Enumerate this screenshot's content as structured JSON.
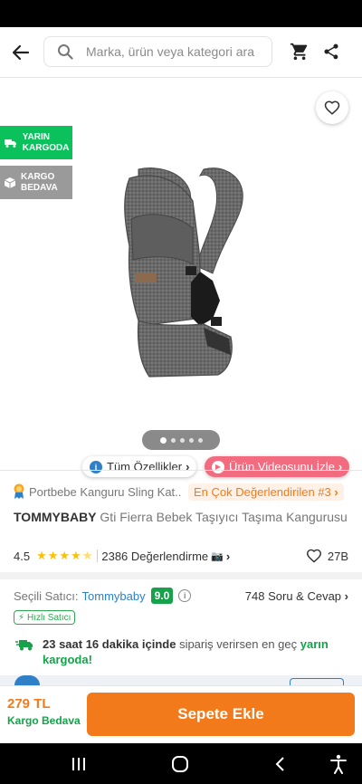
{
  "search": {
    "placeholder": "Marka, ürün veya kategori ara"
  },
  "badges": {
    "tomorrow_cargo": "YARIN KARGODA",
    "free_cargo": "KARGO BEDAVA"
  },
  "pills": {
    "all_features": "Tüm Özellikler",
    "watch_video": "Ürün Videosunu İzle"
  },
  "category": {
    "text": "Portbebe Kanguru Sling Kat...",
    "rank": "En Çok Değerlendirilen #3"
  },
  "product": {
    "brand": "TOMMYBABY",
    "name": "Gti Fierra Bebek Taşıyıcı Taşıma Kangurusu"
  },
  "rating": {
    "score": "4.5",
    "stars": 4.5,
    "reviews": "2386 Değerlendirme",
    "favorites": "27B"
  },
  "seller": {
    "label": "Seçili Satıcı:",
    "name": "Tommybaby",
    "score": "9.0",
    "qa": "748 Soru & Cevap",
    "fast_label": "Hızlı Satıcı"
  },
  "delivery": {
    "time": "23 saat 16 dakika içinde",
    "mid": "sipariş verirsen en geç",
    "day": "yarın kargoda!"
  },
  "bottom": {
    "price": "279 TL",
    "shipping": "Kargo Bedava",
    "add_to_cart": "Sepete Ekle"
  },
  "gallery": {
    "image_count": 5,
    "active_index": 0
  },
  "colors": {
    "accent": "#f27a1a",
    "green": "#15a24a",
    "video": "#f36b7f",
    "link": "#2f80c7"
  }
}
